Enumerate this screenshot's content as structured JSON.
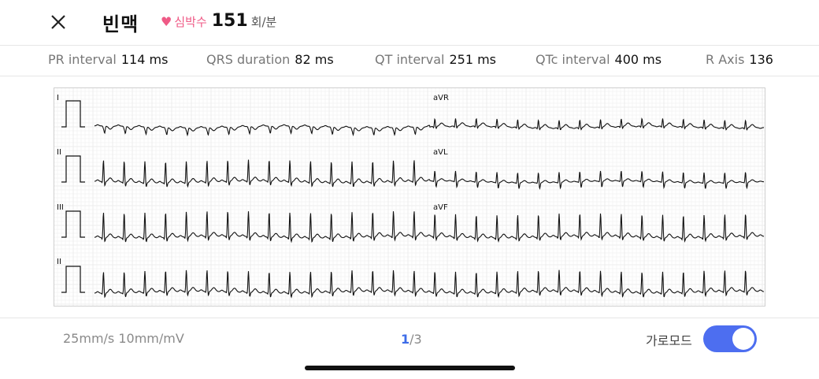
{
  "header": {
    "close_icon": "close-icon",
    "title": "빈맥",
    "heart_icon": "heart-icon",
    "heart_color": "#ef5a86",
    "heart_rate_label": "심박수",
    "heart_rate_value": "151",
    "heart_rate_unit": "회/분"
  },
  "metrics": [
    {
      "label": "PR interval",
      "value": "114 ms"
    },
    {
      "label": "QRS duration",
      "value": "82 ms"
    },
    {
      "label": "QT interval",
      "value": "251 ms"
    },
    {
      "label": "QTc interval",
      "value": "400 ms"
    },
    {
      "label": "R Axis",
      "value": "136"
    }
  ],
  "ecg": {
    "rows": [
      {
        "lead_left": "I",
        "lead_right": "aVR"
      },
      {
        "lead_left": "II",
        "lead_right": "aVL"
      },
      {
        "lead_left": "III",
        "lead_right": "aVF"
      },
      {
        "lead_left": "II",
        "lead_right": ""
      }
    ],
    "grid_color": "#e9e9e9",
    "trace_color": "#111111"
  },
  "footer": {
    "speed_text": "25mm/s 10mm/mV",
    "page_current": "1",
    "page_total": "/3",
    "mode_label": "가로모드",
    "toggle_on": true,
    "toggle_color": "#4d6ef0"
  }
}
